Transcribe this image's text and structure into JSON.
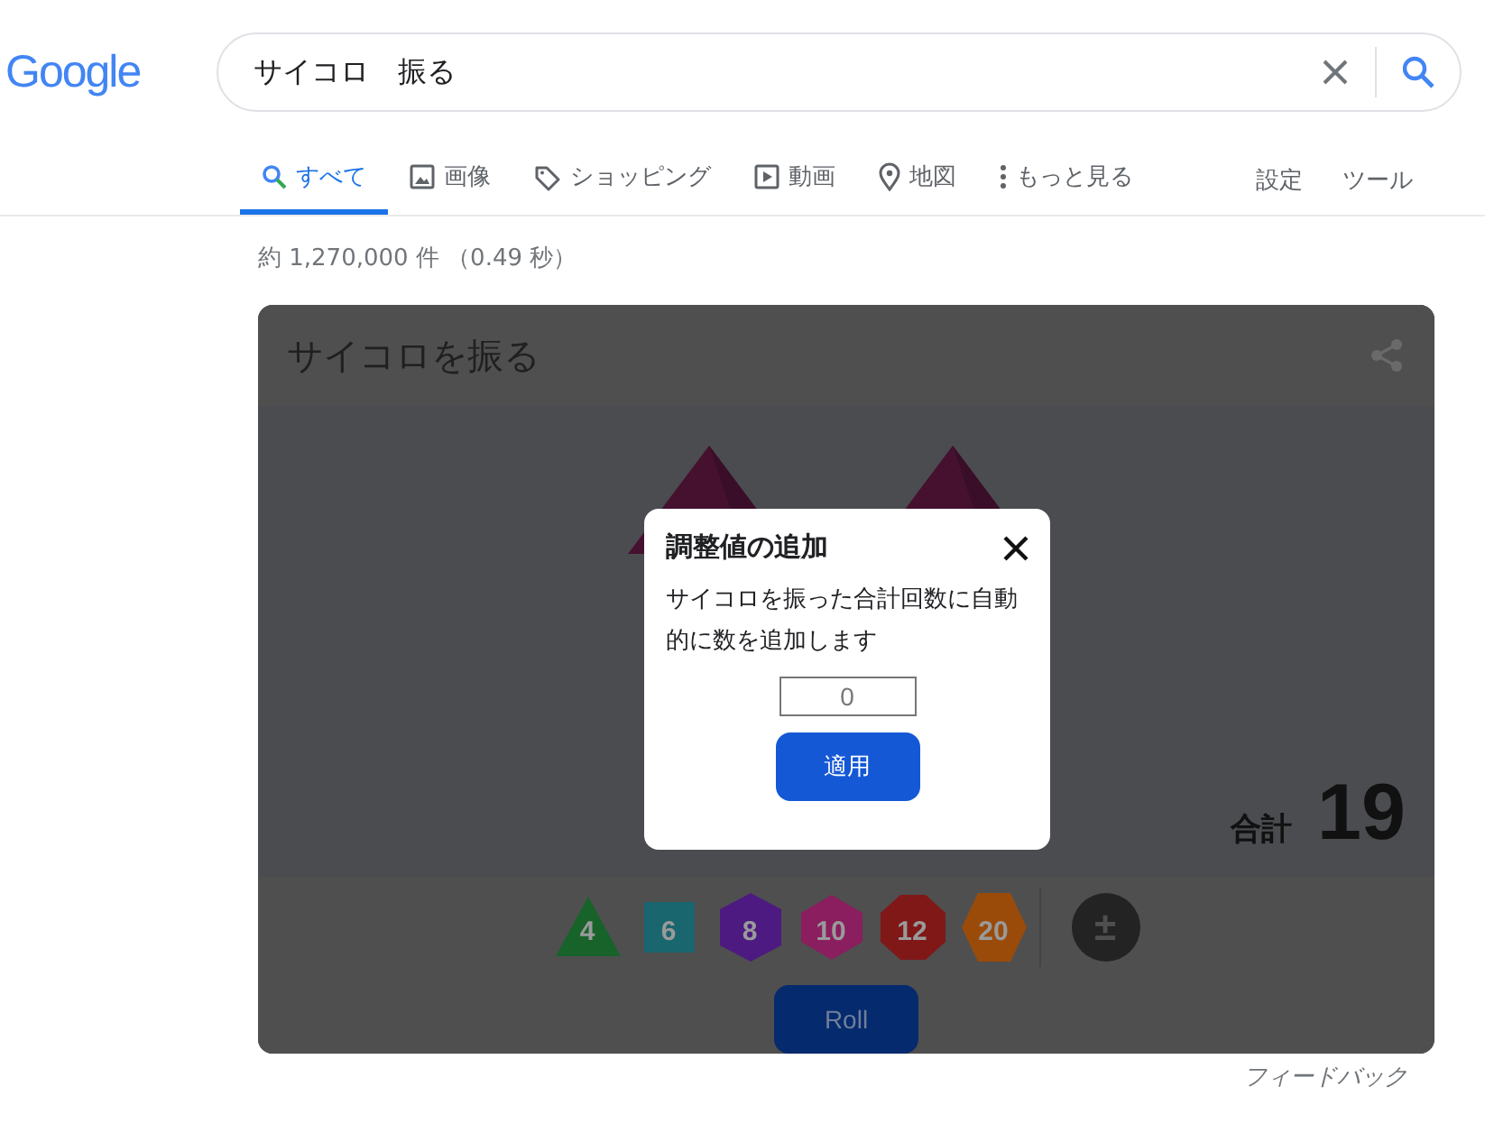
{
  "logo": "Google",
  "search": {
    "value": "サイコロ　振る"
  },
  "tabs": [
    {
      "kind": "search",
      "label": "すべて",
      "selected": true
    },
    {
      "kind": "image",
      "label": "画像",
      "selected": false
    },
    {
      "kind": "tag",
      "label": "ショッピング",
      "selected": false
    },
    {
      "kind": "play",
      "label": "動画",
      "selected": false
    },
    {
      "kind": "pin",
      "label": "地図",
      "selected": false
    },
    {
      "kind": "more",
      "label": "もっと見る",
      "selected": false
    }
  ],
  "tools": [
    "設定",
    "ツール"
  ],
  "result_stats": "約 1,270,000 件 （0.49 秒）",
  "card": {
    "title": "サイコロを振る",
    "total_label": "合計",
    "total": "19",
    "dice": [
      {
        "kind": "d4",
        "label": "4",
        "color": "#176329"
      },
      {
        "kind": "d6",
        "label": "6",
        "color": "#19666e"
      },
      {
        "kind": "d8",
        "label": "8",
        "color": "#4d1a82"
      },
      {
        "kind": "d10",
        "label": "10",
        "color": "#8a1e5e"
      },
      {
        "kind": "d12",
        "label": "12",
        "color": "#801818"
      },
      {
        "kind": "d20",
        "label": "20",
        "color": "#9a4b0a"
      },
      {
        "kind": "modifier",
        "label": "±",
        "color": "#232323"
      }
    ],
    "roll_button": "Roll"
  },
  "dialog": {
    "title": "調整値の追加",
    "text": "サイコロを振った合計回数に自動的に数を追加します",
    "input_value": "0",
    "button": "適用"
  },
  "feedback": "フィードバック"
}
